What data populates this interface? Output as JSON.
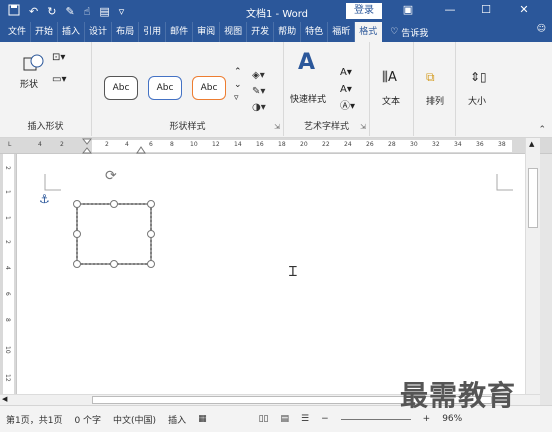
{
  "titlebar": {
    "title": "文档1 - Word",
    "login": "登录",
    "qat": [
      "save-icon",
      "undo-icon",
      "redo-icon",
      "format-painter-icon",
      "touch-mode-icon",
      "new-icon",
      "customize-icon"
    ]
  },
  "tabs": [
    {
      "label": "文件"
    },
    {
      "label": "开始"
    },
    {
      "label": "插入"
    },
    {
      "label": "设计"
    },
    {
      "label": "布局"
    },
    {
      "label": "引用"
    },
    {
      "label": "邮件"
    },
    {
      "label": "审阅"
    },
    {
      "label": "视图"
    },
    {
      "label": "开发"
    },
    {
      "label": "帮助"
    },
    {
      "label": "特色"
    },
    {
      "label": "福昕"
    },
    {
      "label": "格式"
    }
  ],
  "tellme": "告诉我",
  "ribbon": {
    "insert_shapes": {
      "shape_label": "形状",
      "group": "插入形状"
    },
    "shape_styles": {
      "abc": [
        "Abc",
        "Abc",
        "Abc"
      ],
      "group": "形状样式"
    },
    "wordart": {
      "quick_styles": "快速样式",
      "group": "艺术字样式"
    },
    "text": {
      "label": "文本"
    },
    "arrange": {
      "label": "排列"
    },
    "size": {
      "label": "大小"
    }
  },
  "ruler": {
    "h_ticks": [
      "4",
      "2",
      "2",
      "4",
      "6",
      "8",
      "10",
      "12",
      "14",
      "16",
      "18",
      "20",
      "22",
      "24",
      "26",
      "28",
      "30",
      "32",
      "34",
      "36",
      "38"
    ],
    "v_ticks": [
      "2",
      "1",
      "1",
      "2",
      "4",
      "6",
      "8",
      "10",
      "12"
    ]
  },
  "status": {
    "page": "第1页，共1页",
    "words": "0 个字",
    "lang": "中文(中国)",
    "mode": "插入",
    "zoom": "96%"
  },
  "watermark": "最需教育",
  "colors": {
    "brand": "#2b579a",
    "ribbon_bg": "#f3f3f3"
  }
}
